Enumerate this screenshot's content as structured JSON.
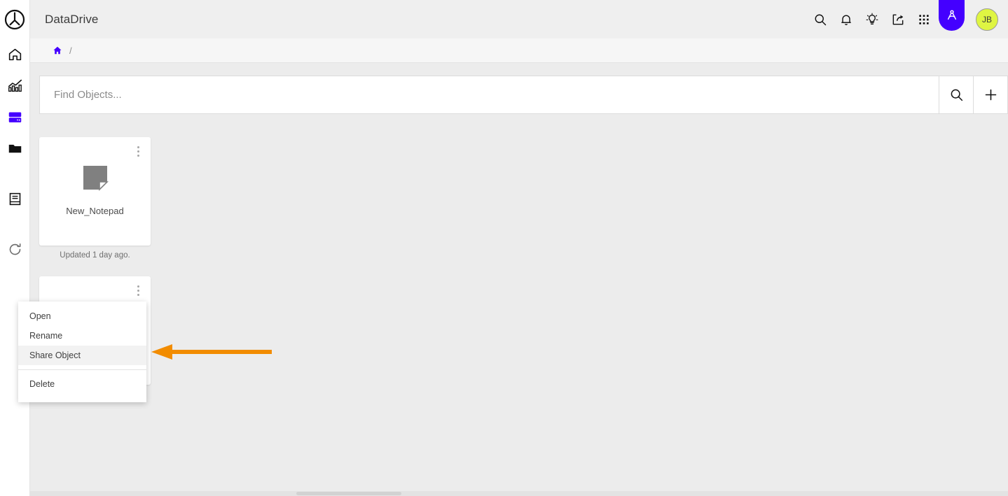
{
  "app": {
    "title": "DataDrive",
    "accent_purple": "#4400ff",
    "avatar_color": "#dff542",
    "content_bg": "#ececec",
    "annotation_color": "#f28c00"
  },
  "sidebar": {
    "logo_name": "brand-logo",
    "items": [
      {
        "name": "home",
        "icon": "home-icon",
        "active": false
      },
      {
        "name": "analytics",
        "icon": "chart-bar-icon",
        "active": false
      },
      {
        "name": "database",
        "icon": "database-icon",
        "active": true
      },
      {
        "name": "files",
        "icon": "folder-icon",
        "active": false
      },
      {
        "name": "notebook",
        "icon": "book-icon",
        "active": false
      },
      {
        "name": "refresh",
        "icon": "refresh-icon",
        "active": false
      }
    ]
  },
  "topbar": {
    "title": "DataDrive",
    "actions": [
      {
        "name": "search",
        "icon": "search-icon"
      },
      {
        "name": "notifications",
        "icon": "bell-icon"
      },
      {
        "name": "insights",
        "icon": "lightbulb-icon"
      },
      {
        "name": "share",
        "icon": "share-icon"
      },
      {
        "name": "apps",
        "icon": "grid-apps-icon"
      }
    ],
    "highlighted_action": {
      "name": "designer",
      "icon": "compass-icon"
    },
    "avatar_initials": "JB"
  },
  "breadcrumb": {
    "home_icon": "home-icon",
    "separator": "/"
  },
  "search": {
    "placeholder": "Find Objects...",
    "value": "",
    "search_button_icon": "search-icon",
    "add_button_icon": "plus-icon"
  },
  "objects": [
    {
      "name": "New_Notepad",
      "icon": "note-page-icon",
      "meta": "Updated 1 day ago."
    },
    {
      "name": "",
      "icon": "folder-icon",
      "meta": ""
    }
  ],
  "context_menu": {
    "items": [
      {
        "label": "Open",
        "active": false,
        "separator_after": false
      },
      {
        "label": "Rename",
        "active": false,
        "separator_after": false
      },
      {
        "label": "Share Object",
        "active": true,
        "separator_after": true
      },
      {
        "label": "Delete",
        "active": false,
        "separator_after": false
      }
    ]
  },
  "annotation": {
    "type": "arrow",
    "direction": "left",
    "target": "Share Object"
  }
}
